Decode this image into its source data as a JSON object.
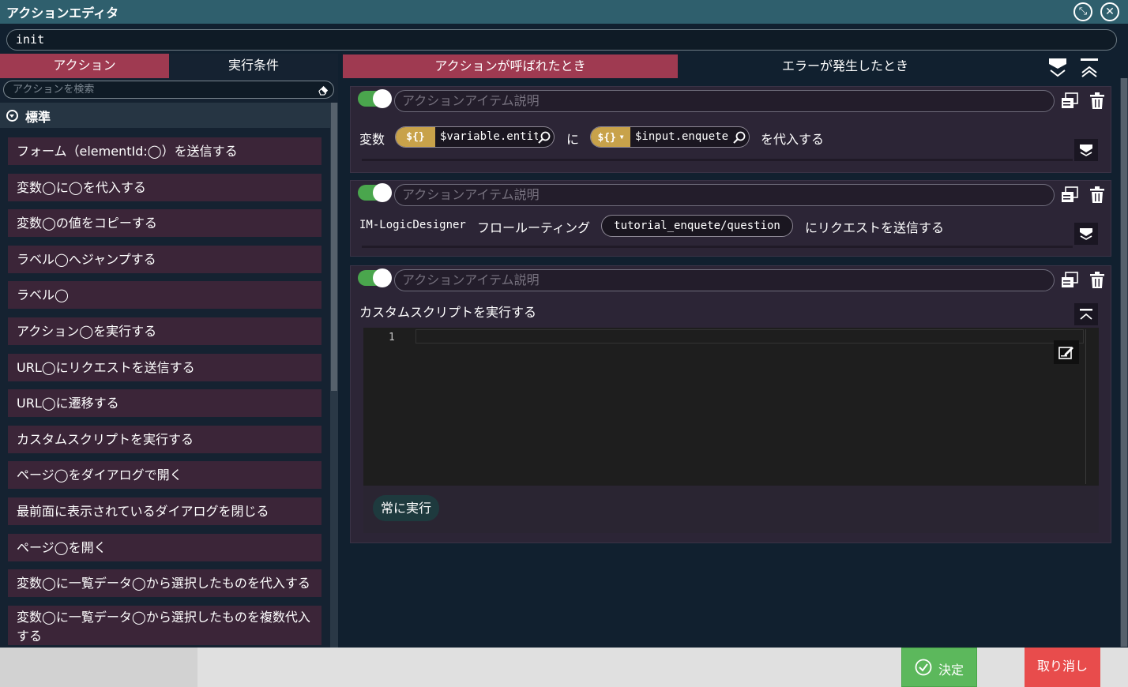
{
  "window": {
    "title": "アクションエディタ",
    "action_name": "init"
  },
  "left_panel": {
    "tabs": [
      {
        "label": "アクション",
        "active": true
      },
      {
        "label": "実行条件",
        "active": false
      }
    ],
    "search_placeholder": "アクションを検索",
    "group_label": "標準",
    "items": [
      {
        "label": "フォーム（elementId:◯）を送信する"
      },
      {
        "label": "変数◯に◯を代入する"
      },
      {
        "label": "変数◯の値をコピーする"
      },
      {
        "label": "ラベル◯へジャンプする"
      },
      {
        "label": "ラベル◯"
      },
      {
        "label": "アクション◯を実行する"
      },
      {
        "label": "URL◯にリクエストを送信する"
      },
      {
        "label": "URL◯に遷移する"
      },
      {
        "label": "カスタムスクリプトを実行する"
      },
      {
        "label": "ページ◯をダイアログで開く"
      },
      {
        "label": "最前面に表示されているダイアログを閉じる"
      },
      {
        "label": "ページ◯を開く"
      },
      {
        "label": "変数◯に一覧データ◯から選択したものを代入する"
      },
      {
        "label": "変数◯に一覧データ◯から選択したものを複数代入する"
      }
    ]
  },
  "right_panel": {
    "tabs": [
      {
        "label": "アクションが呼ばれたとき",
        "active": true
      },
      {
        "label": "エラーが発生したとき",
        "active": false
      }
    ],
    "description_placeholder": "アクションアイテム説明",
    "cards": [
      {
        "prefix": "変数",
        "target_badge": "${}",
        "target_value": "$variable.entity",
        "connector": "に",
        "source_badge": "${}",
        "source_value": "$input.enquete",
        "suffix": "を代入する"
      },
      {
        "prefix": "IM-LogicDesigner",
        "middle": "フロールーティング",
        "route_value": "tutorial_enquete/question",
        "suffix": "にリクエストを送信する"
      },
      {
        "title": "カスタムスクリプトを実行する",
        "line_number": "1",
        "condition_label": "常に実行"
      }
    ]
  },
  "footer": {
    "ok_label": "決定",
    "cancel_label": "取り消し"
  },
  "colors": {
    "titlebar": "#2f5f6d",
    "active_tab": "#9f3a51",
    "toggle_on": "#4aa64d",
    "badge": "#c8a24a",
    "ok": "#5cb85c",
    "cancel": "#e84c4c"
  },
  "icons": [
    "shrink-icon",
    "close-icon",
    "eraser-icon",
    "expand-all-icon",
    "collapse-all-icon",
    "duplicate-icon",
    "trash-icon",
    "search-icon",
    "chevron-down-icon",
    "chevron-up-icon",
    "edit-icon",
    "check-circle-icon"
  ]
}
